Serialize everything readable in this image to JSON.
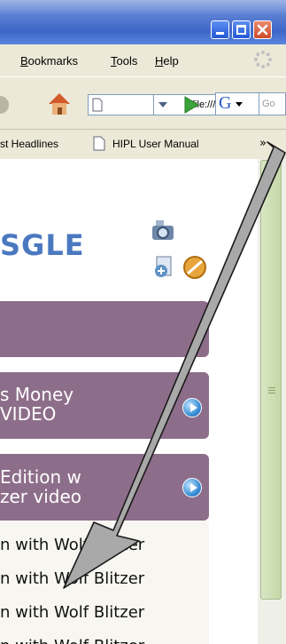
{
  "menu": {
    "items": [
      "Bookmarks",
      "Tools",
      "Help"
    ]
  },
  "nav": {
    "url_value": "file:///",
    "search_engine_letter": "G",
    "search_placeholder": "Go"
  },
  "bookmarks": {
    "items": [
      "st Headlines",
      "HIPL User Manual"
    ],
    "overflow": "»"
  },
  "content": {
    "logo_text": "SGLE",
    "sections": [
      {
        "title_line1": "",
        "title_line2": ""
      },
      {
        "title_line1": "s Money",
        "title_line2": "VIDEO"
      },
      {
        "title_line1": "Edition w",
        "title_line2": "zer video"
      }
    ],
    "list_items": [
      "n with Wolf Blitzer",
      "n with Wolf Blitzer",
      "n with Wolf Blitzer",
      "n with Wolf Blitzer"
    ]
  },
  "colors": {
    "section_bg": "#8d6e8a",
    "logo_blue": "#4a79c0",
    "arrow_fill": "#a9a9a9"
  }
}
